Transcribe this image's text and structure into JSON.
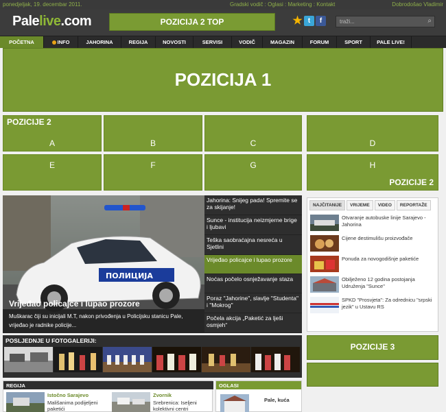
{
  "topbar": {
    "date": "ponedjeljak, 19. decembar 2011.",
    "links": "Gradski vodič : Oglasi : Marketing : Kontakt",
    "welcome": "Dobrodošao Vladimir"
  },
  "header": {
    "logo_a": "Pale",
    "logo_b": "live",
    "logo_c": ".com",
    "top_banner": "POZICIJA 2 TOP",
    "search_placeholder": "traži..."
  },
  "nav": {
    "items": [
      "POČETNA",
      "INFO",
      "JAHORINA",
      "REGIJA",
      "NOVOSTI",
      "SERVISI",
      "VODIČ",
      "MAGAZIN",
      "FORUM",
      "SPORT",
      "PALE LIVE!"
    ]
  },
  "poz1": "POZICIJA 1",
  "poz2": {
    "title": "POZICIJE 2",
    "cells": [
      "A",
      "B",
      "C",
      "D",
      "E",
      "F",
      "G",
      "H"
    ],
    "footer": "POZICIJE 2"
  },
  "feature": {
    "caption": "Vrijeđao policajce i lupao prozore",
    "summary": "Muškarac čiji su inicijali M.T, nakon privođenja u Policijsku stanicu Pale, vrijeđao je radnike policije..."
  },
  "headlines": [
    "Jahorina: Snijeg pada! Spremite se za skijanje!",
    "Sunce - institucija neizmjerne brige i ljubavi",
    "Teška saobraćajna nesreća u Sjetlini",
    "Vrijeđao policajce i lupao prozore",
    "Noćas počelo osnježavanje staza",
    "Poraz \"Jahorine\", slavlje \"Studenta\" i \"Mokrog\"",
    "Počela akcija „Paketić za lješi osmjeh“"
  ],
  "tabs": {
    "labels": [
      "NAJČITANIJE",
      "VRIJEME",
      "VIDEO",
      "REPORTAŽE"
    ],
    "items": [
      "Otvaranje autobuske linije Sarajevo - Jahorina",
      "Cijene destimulišu proizvođače",
      "Ponuda za novogodišnje paketiće",
      "Obilježeno 12 godina postojanja Udruženja \"Sunce\"",
      "SPKD \"Prosvjeta\": Za odrednicu \"srpski jezik\" u Ustavu RS"
    ]
  },
  "gallery": {
    "title": "POSLJEDNJE U FOTOGALERIJI:"
  },
  "poz3": "POZICIJE 3",
  "regija": {
    "title": "REGIJA",
    "items": [
      {
        "place": "Istočno Sarajevo",
        "text": "Mališanima podijeljeni paketići"
      },
      {
        "place": "Zvornik",
        "text": "Srebrenica: Iseljeni kolektivni centri"
      }
    ]
  },
  "oglasi": {
    "title": "OGLASI",
    "item": "Pale, kuća"
  },
  "colors": {
    "accent": "#7a9a33",
    "dark": "#2e2e2e",
    "link": "#8fb836"
  }
}
